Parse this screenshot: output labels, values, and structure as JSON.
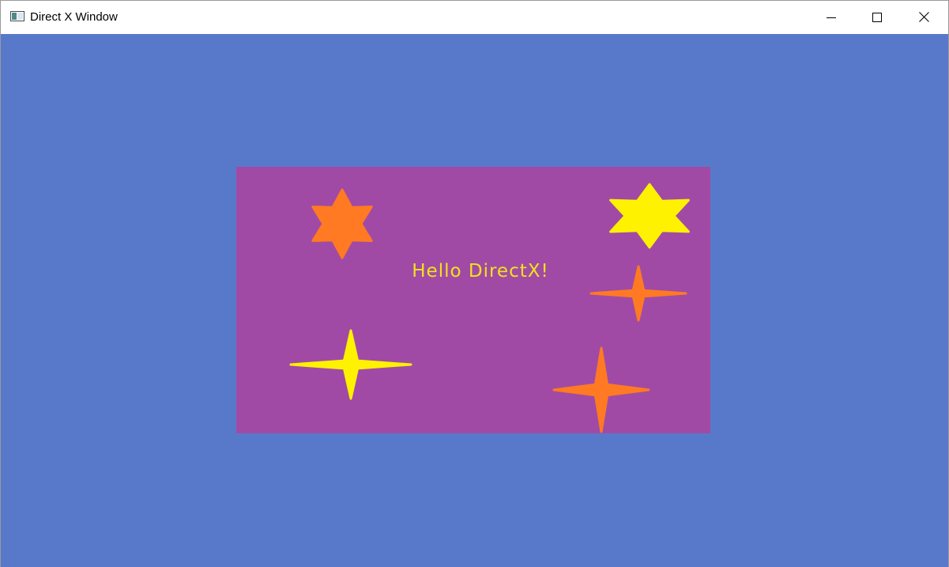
{
  "window": {
    "title": "Direct X Window",
    "icon": "app-window-icon",
    "controls": {
      "minimize_icon": "minimize-icon",
      "maximize_icon": "maximize-icon",
      "close_icon": "close-icon"
    }
  },
  "scene": {
    "background_color": "#5879CA",
    "panel_color": "#A14AA5",
    "text": "Hello DirectX!",
    "text_color": "#F2E21C",
    "colors": {
      "orange": "#FF7A22",
      "yellow": "#FFF200"
    }
  }
}
